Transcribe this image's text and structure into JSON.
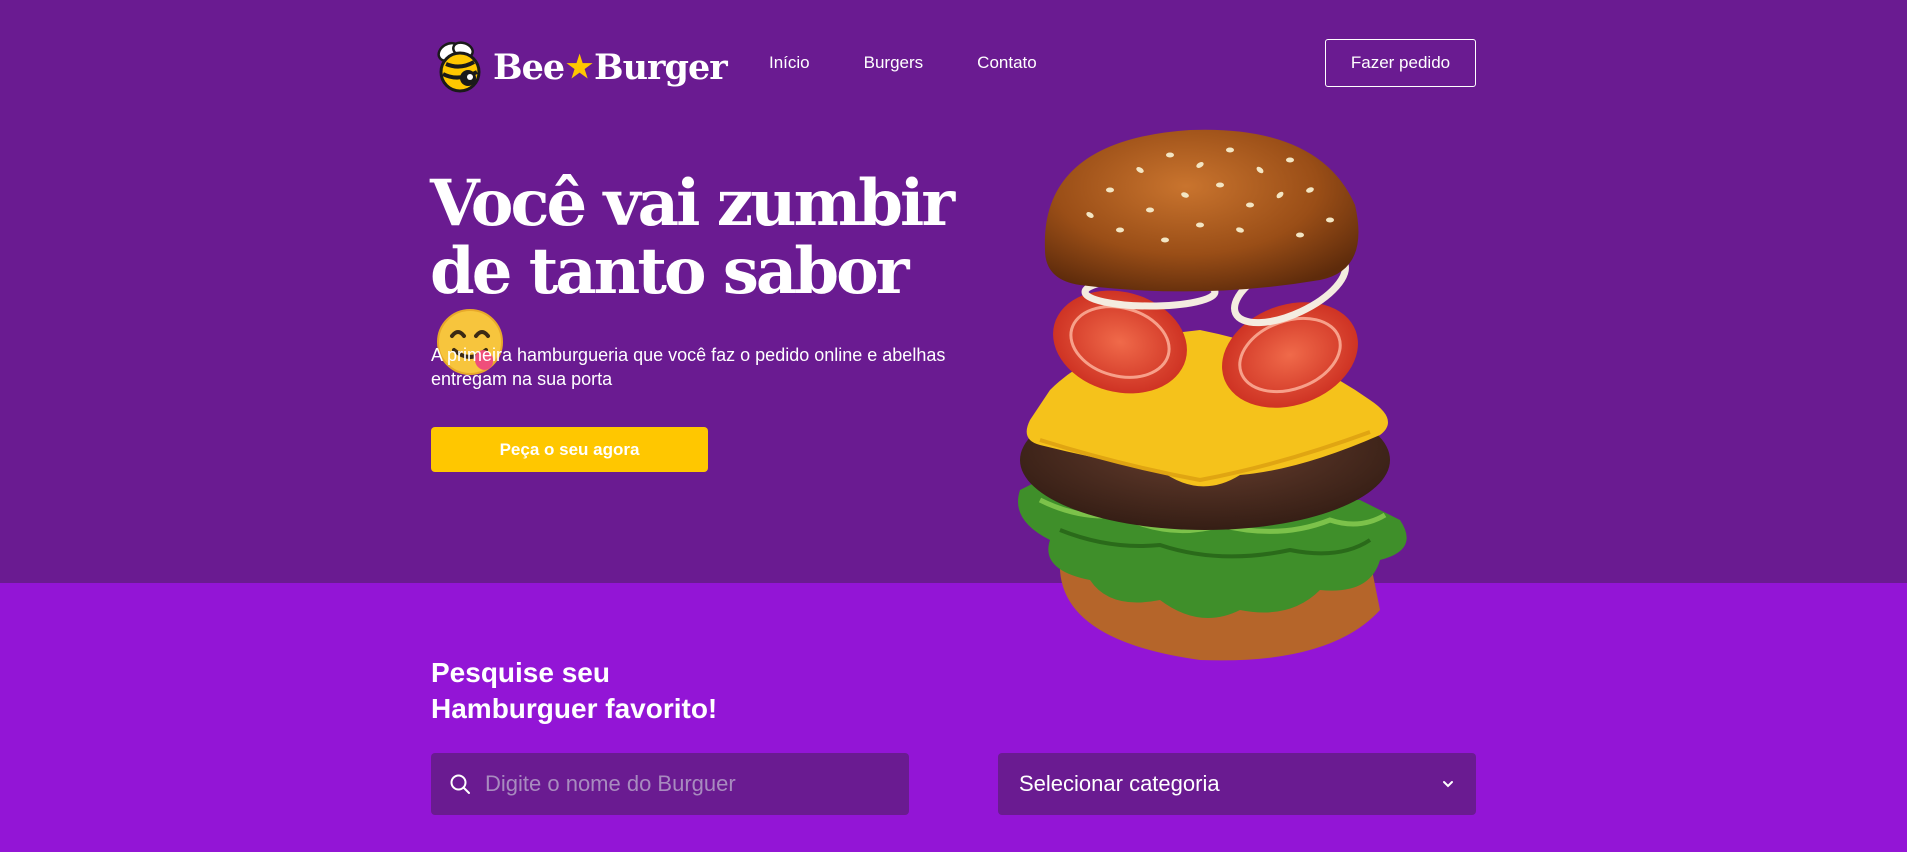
{
  "brand": {
    "name_left": "Bee",
    "name_right": "Burger",
    "star": "★"
  },
  "nav": {
    "items": [
      {
        "label": "Início"
      },
      {
        "label": "Burgers"
      },
      {
        "label": "Contato"
      }
    ]
  },
  "header": {
    "order_button": "Fazer pedido"
  },
  "hero": {
    "headline_line1": "Você vai zumbir",
    "headline_line2": "de tanto sabor",
    "emoji": "face-savoring-food-icon",
    "subtitle": "A primeira hamburgueria que você faz o pedido online e abelhas entregam na sua porta",
    "cta": "Peça o seu agora",
    "image": "floating-cheeseburger"
  },
  "search": {
    "title_line1": "Pesquise seu",
    "title_line2": "Hamburguer favorito!",
    "placeholder": "Digite o nome do Burguer",
    "category_selected": "Selecionar categoria"
  },
  "colors": {
    "hero_bg": "#6a1b91",
    "section_bg": "#9315d6",
    "accent": "#ffc700"
  }
}
